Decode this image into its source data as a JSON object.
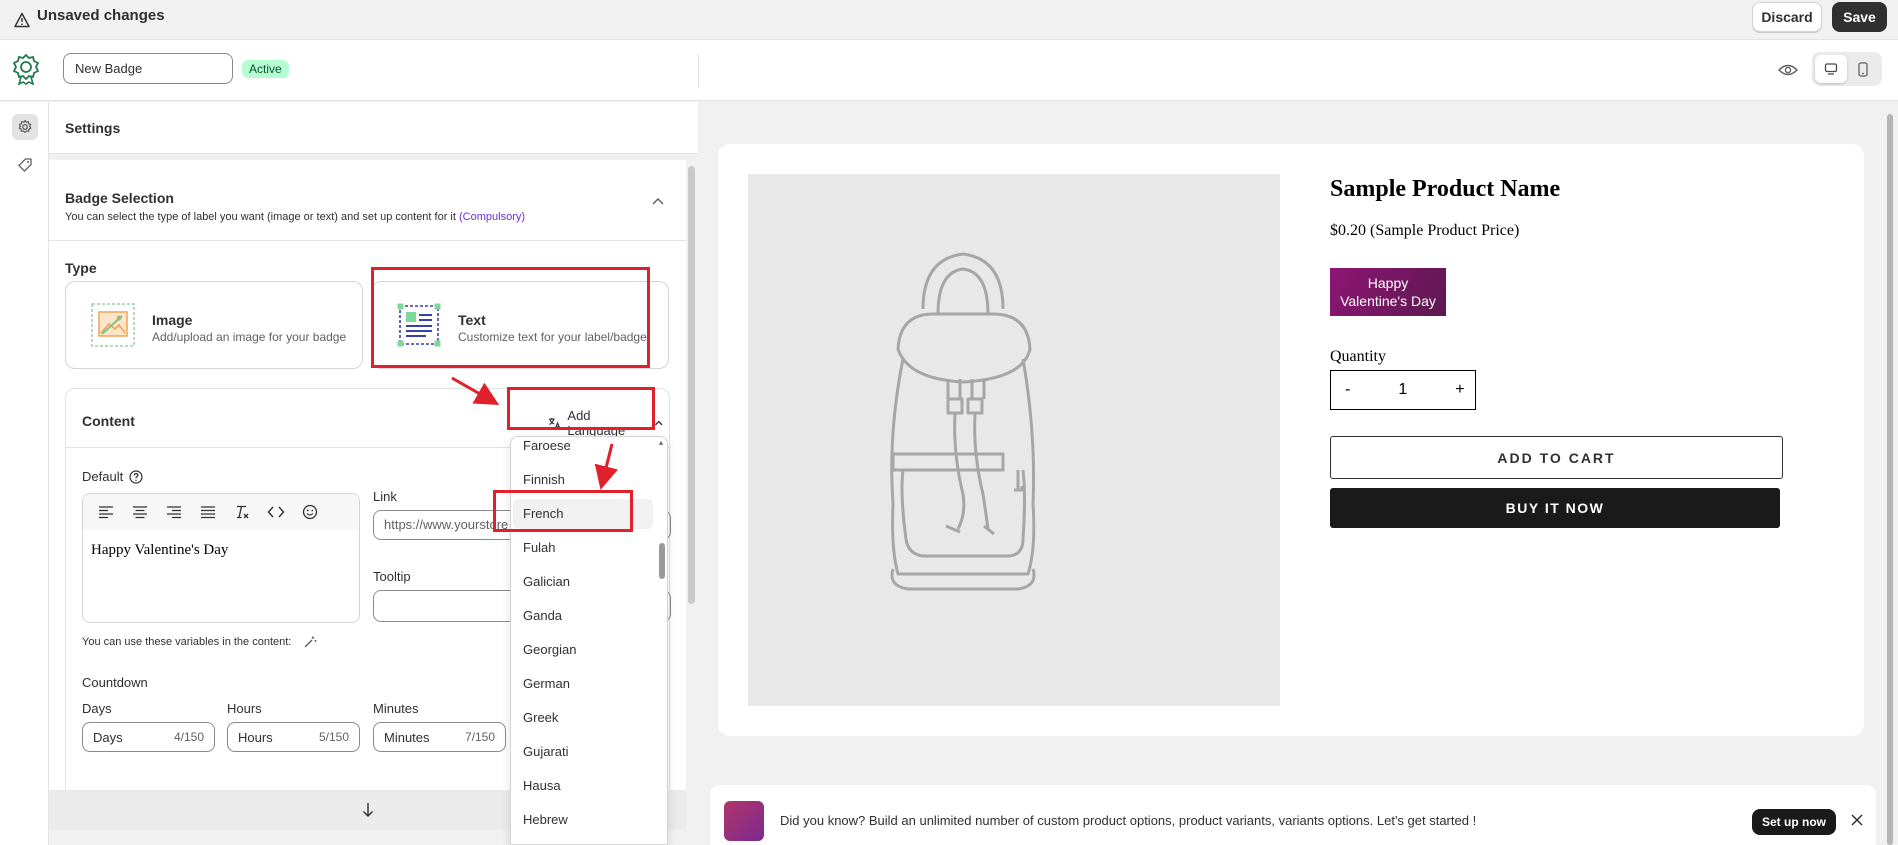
{
  "topbar": {
    "unsaved_label": "Unsaved changes",
    "discard_label": "Discard",
    "save_label": "Save"
  },
  "header": {
    "badge_name_value": "New Badge",
    "status_badge": "Active"
  },
  "settings": {
    "title": "Settings",
    "badge_selection": {
      "title": "Badge Selection",
      "description": "You can select the type of label you want (image or text) and set up content for it",
      "compulsory": "(Compulsory)"
    },
    "type": {
      "label": "Type",
      "image": {
        "title": "Image",
        "desc": "Add/upload an image for your badge"
      },
      "text": {
        "title": "Text",
        "desc": "Customize text for your label/badge"
      }
    },
    "content": {
      "title": "Content",
      "add_language": "Add Language",
      "default_label": "Default",
      "editor_text": "Happy Valentine's Day",
      "link_label": "Link",
      "link_placeholder": "https://www.yourstore",
      "tooltip_label": "Tooltip",
      "vars_note": "You can use these variables in the content:",
      "countdown_label": "Countdown",
      "countdown": [
        {
          "label": "Days",
          "value": "Days",
          "count": "4/150"
        },
        {
          "label": "Hours",
          "value": "Hours",
          "count": "5/150"
        },
        {
          "label": "Minutes",
          "value": "Minutes",
          "count": "7/150"
        }
      ]
    }
  },
  "language_dropdown": {
    "options": [
      "Faroese",
      "Finnish",
      "French",
      "Fulah",
      "Galician",
      "Ganda",
      "Georgian",
      "German",
      "Greek",
      "Gujarati",
      "Hausa",
      "Hebrew"
    ],
    "highlighted": "French"
  },
  "preview": {
    "product_name": "Sample Product Name",
    "product_price": "$0.20 (Sample Product Price)",
    "badge_line1": "Happy",
    "badge_line2": "Valentine's Day",
    "badge_colors": [
      "#8d1674",
      "#5d1850"
    ],
    "quantity_label": "Quantity",
    "qty_minus": "-",
    "qty_value": "1",
    "qty_plus": "+",
    "add_to_cart": "ADD TO CART",
    "buy_now": "BUY IT NOW"
  },
  "banner": {
    "text": "Did you know? Build an unlimited number of custom product options, product variants, variants options. Let's get started !",
    "button": "Set up now"
  },
  "annotation_color": "#e0202a"
}
